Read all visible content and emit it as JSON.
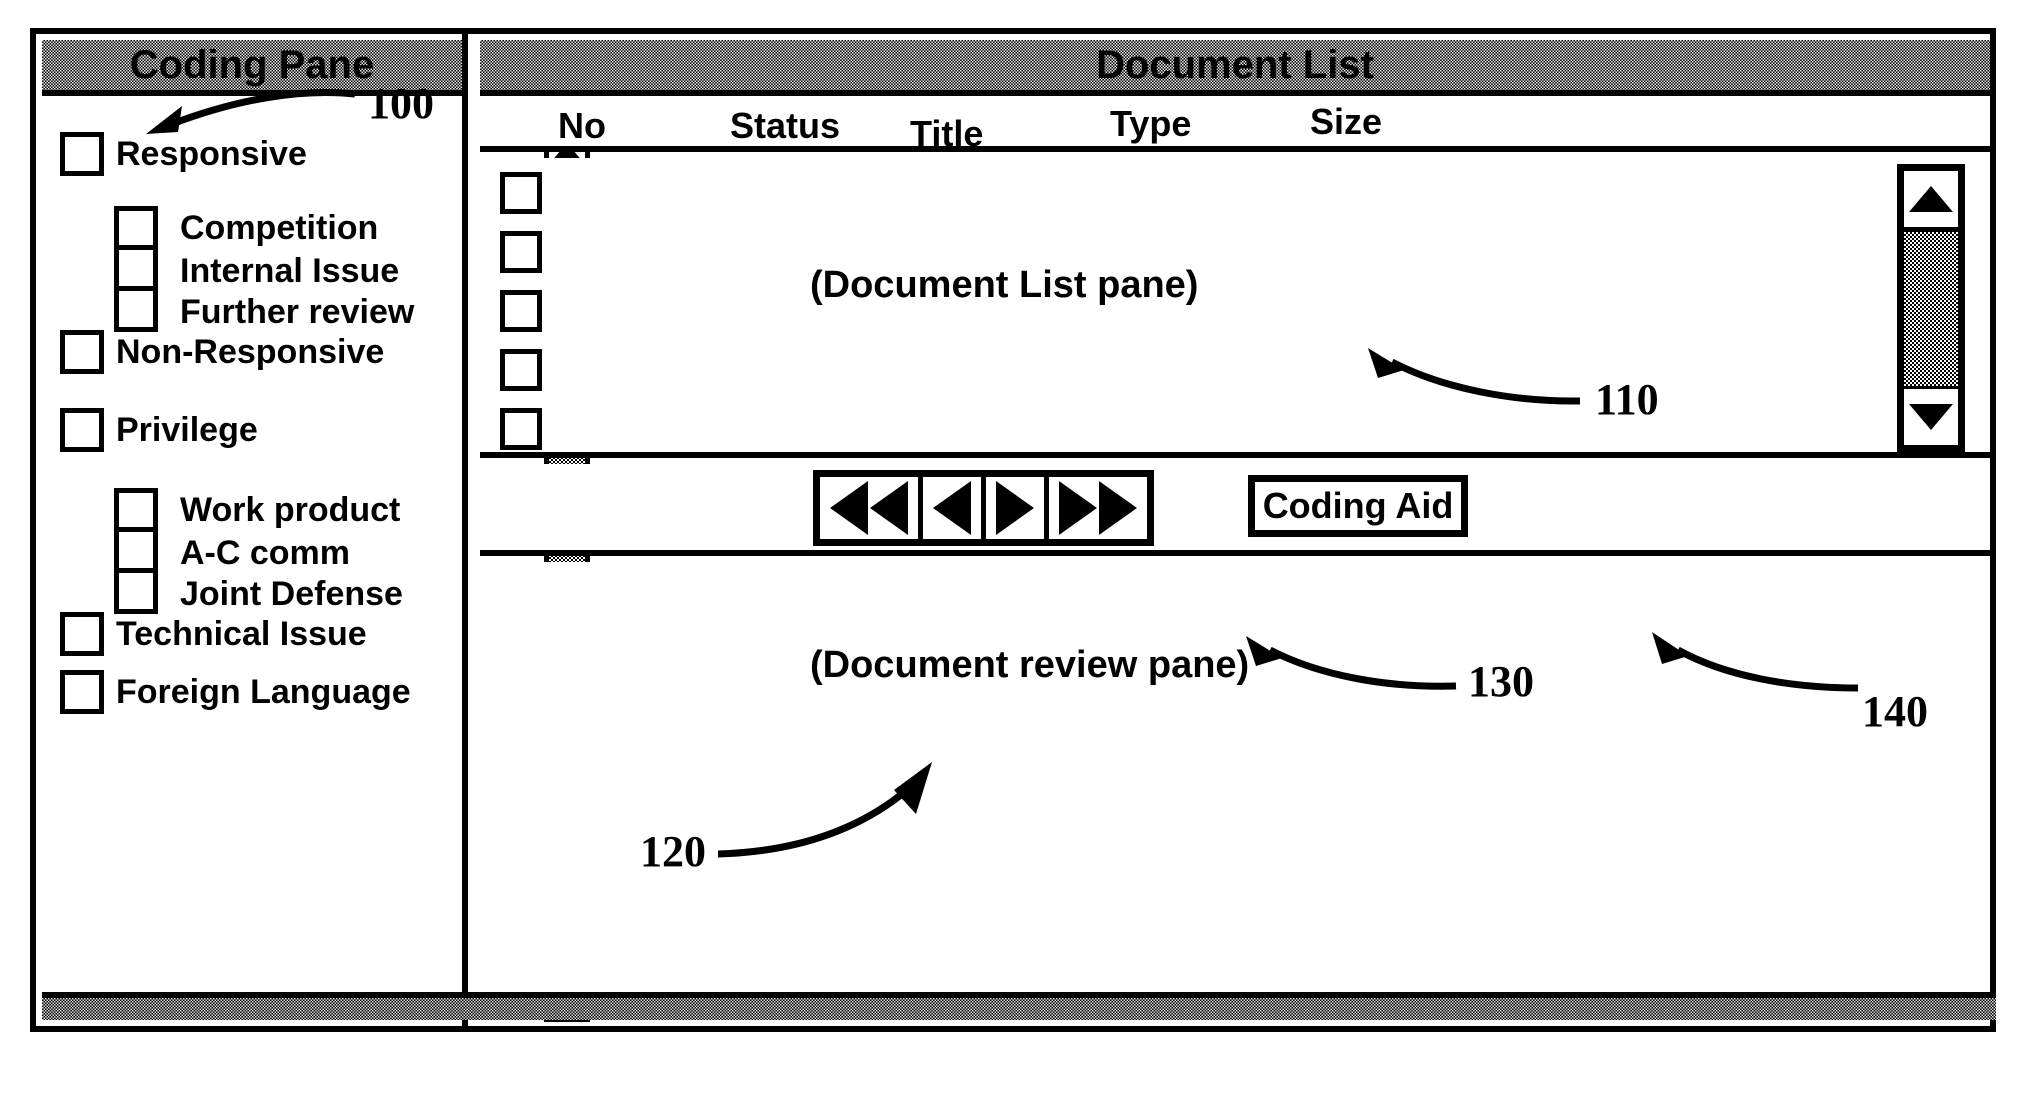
{
  "window": {
    "coding_pane_title": "Coding Pane",
    "document_list_title": "Document List"
  },
  "coding_pane": {
    "items": [
      {
        "label": "Responsive",
        "level": "top"
      },
      {
        "label": "Competition",
        "level": "nested"
      },
      {
        "label": "Internal Issue",
        "level": "nested"
      },
      {
        "label": "Further review",
        "level": "nested"
      },
      {
        "label": "Non-Responsive",
        "level": "top"
      },
      {
        "label": "Privilege",
        "level": "top"
      },
      {
        "label": "Work product",
        "level": "nested"
      },
      {
        "label": "A-C comm",
        "level": "nested"
      },
      {
        "label": "Joint Defense",
        "level": "nested"
      },
      {
        "label": "Technical Issue",
        "level": "top"
      },
      {
        "label": "Foreign Language",
        "level": "top"
      }
    ]
  },
  "document_list": {
    "columns": [
      "No",
      "Status",
      "Title",
      "Type",
      "Size"
    ],
    "row_count": 5,
    "placeholder_caption": "(Document List pane)"
  },
  "toolbar": {
    "nav_buttons": [
      {
        "name": "first",
        "glyph": "double-left-arrow-icon"
      },
      {
        "name": "previous",
        "glyph": "left-arrow-icon"
      },
      {
        "name": "next",
        "glyph": "right-arrow-icon"
      },
      {
        "name": "last",
        "glyph": "double-right-arrow-icon"
      }
    ],
    "coding_aid_label": "Coding Aid"
  },
  "review_pane": {
    "placeholder_caption": "(Document review pane)"
  },
  "callouts": [
    {
      "id": "100",
      "label": "100",
      "target": "coding-pane"
    },
    {
      "id": "110",
      "label": "110",
      "target": "document-list-pane"
    },
    {
      "id": "120",
      "label": "120",
      "target": "document-review-pane"
    },
    {
      "id": "130",
      "label": "130",
      "target": "navigation-buttons"
    },
    {
      "id": "140",
      "label": "140",
      "target": "coding-aid-button"
    }
  ],
  "colors": {
    "line": "#000000",
    "background": "#ffffff",
    "titlebar_fill": "#e8e8e8",
    "scroll_track": "#d9d9d9"
  }
}
